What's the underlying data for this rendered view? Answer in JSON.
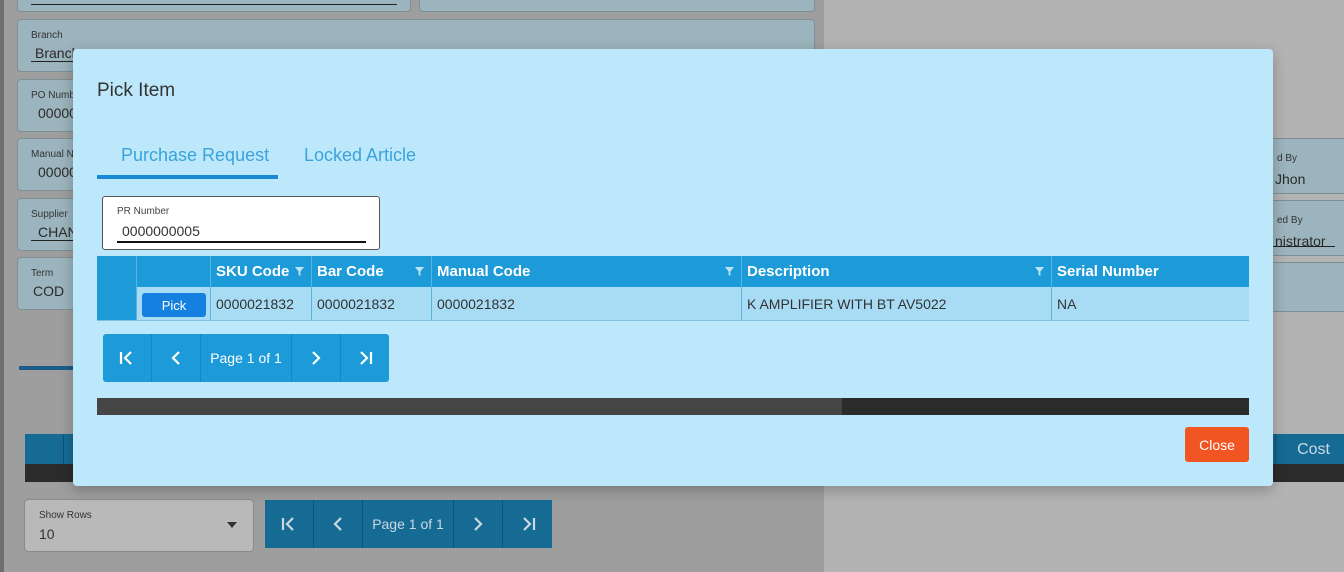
{
  "background": {
    "branch": {
      "label": "Branch",
      "value": "Branch"
    },
    "po_number": {
      "label": "PO Numb",
      "value": "00000"
    },
    "manual_no": {
      "label": "Manual N",
      "value": "00000"
    },
    "supplier": {
      "label": "Supplier",
      "value": "CHAN"
    },
    "term": {
      "label": "Term",
      "value": "COD"
    },
    "created_by": {
      "label": "d By",
      "value": "Jhon"
    },
    "approved_by": {
      "label": "ed By",
      "value": "nistrator"
    },
    "table_cost_header": "Cost",
    "show_rows": {
      "label": "Show Rows",
      "value": "10"
    },
    "pager": {
      "page_text": "Page 1 of 1"
    }
  },
  "modal": {
    "title": "Pick Item",
    "tabs": [
      {
        "label": "Purchase Request",
        "active": true
      },
      {
        "label": "Locked Article",
        "active": false
      }
    ],
    "pr_number": {
      "label": "PR Number",
      "value": "0000000005"
    },
    "grid": {
      "columns": [
        "SKU Code",
        "Bar Code",
        "Manual Code",
        "Description",
        "Serial Number"
      ],
      "rows": [
        {
          "action": "Pick",
          "sku_code": "0000021832",
          "bar_code": "0000021832",
          "manual_code": "0000021832",
          "description": "K AMPLIFIER WITH BT AV5022",
          "serial_number": "NA"
        }
      ]
    },
    "pager": {
      "page_text": "Page 1 of 1"
    },
    "close_label": "Close"
  },
  "colors": {
    "modal_bg": "#bde8fb",
    "header_blue": "#1d9ad8",
    "pick_button": "#1481e0",
    "close_button": "#f05522",
    "tab_text": "#3aa3d9"
  }
}
